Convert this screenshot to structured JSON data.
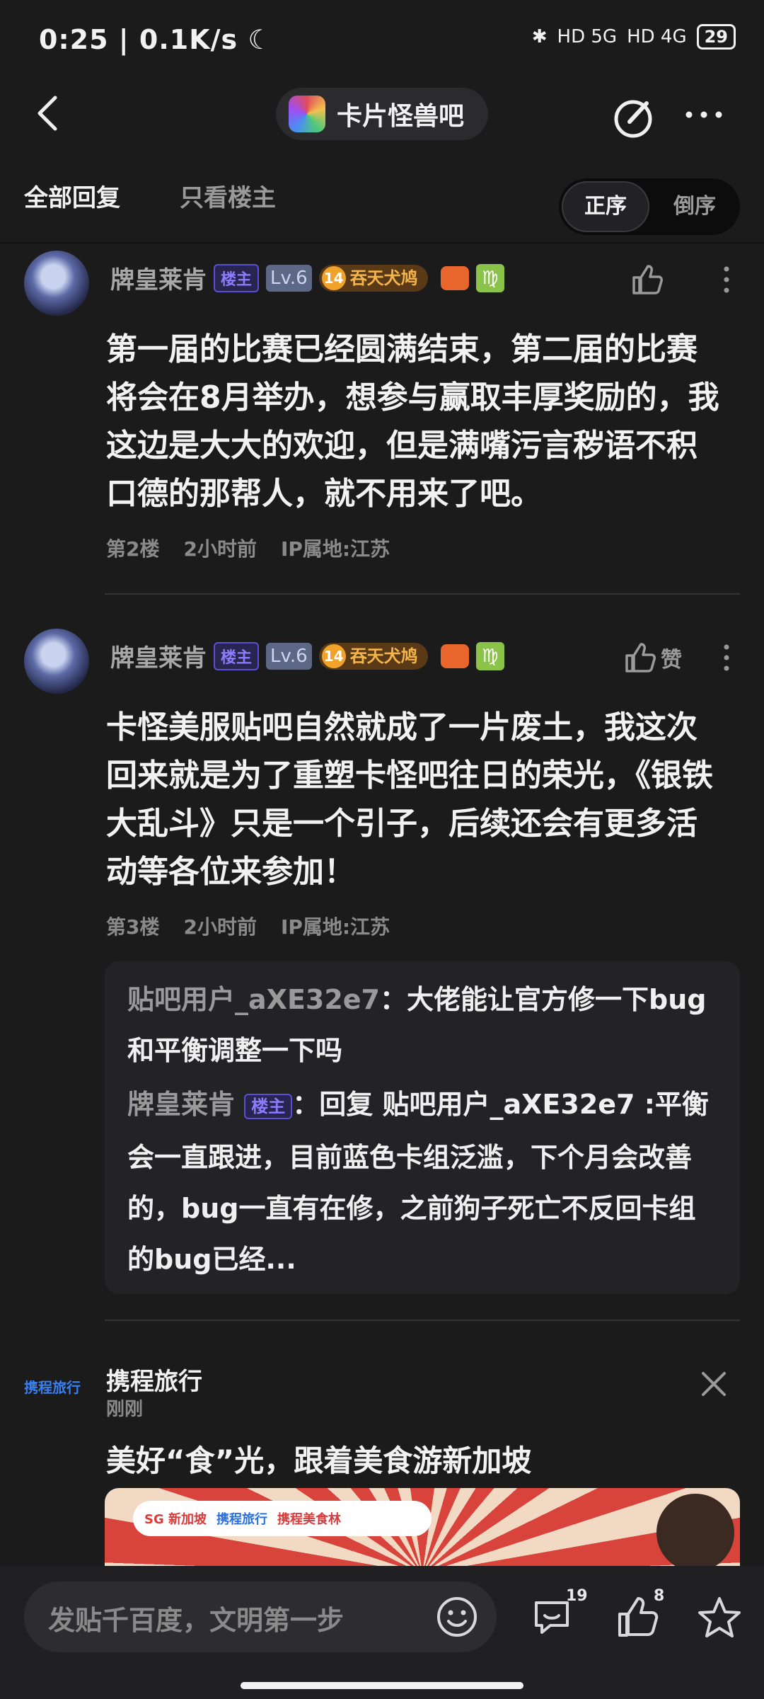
{
  "status_bar": {
    "time": "0:25",
    "speed": "0.1K/s",
    "net1": "HD 5G",
    "net2": "HD 4G",
    "battery": "29"
  },
  "header": {
    "forum_name": "卡片怪兽吧",
    "back_icon": "chevron-left-icon",
    "edit_icon": "edit-icon",
    "more_icon": "more-icon"
  },
  "tabs": {
    "all": "全部回复",
    "owner_only": "只看楼主",
    "sort_asc": "正序",
    "sort_desc": "倒序"
  },
  "posts": [
    {
      "username": "牌皇莱肯",
      "owner_badge": "楼主",
      "level": "Lv.6",
      "title_num": "14",
      "title": "吞天犬鸠",
      "zodiac": "♍",
      "like_label": "",
      "body": "第一届的比赛已经圆满结束，第二届的比赛将会在8月举办，想参与赢取丰厚奖励的，我这边是大大的欢迎，但是满嘴污言秽语不积口德的那帮人，就不用来了吧。",
      "floor": "第2楼",
      "time": "2小时前",
      "ip": "IP属地:江苏"
    },
    {
      "username": "牌皇莱肯",
      "owner_badge": "楼主",
      "level": "Lv.6",
      "title_num": "14",
      "title": "吞天犬鸠",
      "zodiac": "♍",
      "like_label": "赞",
      "body": "卡怪美服贴吧自然就成了一片废土，我这次回来就是为了重塑卡怪吧往日的荣光，《银铁大乱斗》只是一个引子，后续还会有更多活动等各位来参加！",
      "floor": "第3楼",
      "time": "2小时前",
      "ip": "IP属地:江苏",
      "replies": [
        {
          "user": "贴吧用户_aXE32e7",
          "text": "：大佬能让官方修一下bug和平衡调整一下吗"
        },
        {
          "user": "牌皇莱肯",
          "badge": "楼主",
          "text": "：回复 贴吧用户_aXE32e7 :平衡会一直跟进，目前蓝色卡组泛滥，下个月会改善的，bug一直有在修，之前狗子死亡不反回卡组的bug已经..."
        }
      ]
    }
  ],
  "ad": {
    "logo_text": "携程旅行",
    "advertiser": "携程旅行",
    "time": "刚刚",
    "headline": "美好“食”光，跟着美食游新加坡",
    "banner_items": [
      "SG 新加坡",
      "携程旅行",
      "携程美食林"
    ]
  },
  "bottom_bar": {
    "placeholder": "发贴千百度，文明第一步",
    "comment_count": "19",
    "like_count": "8"
  }
}
